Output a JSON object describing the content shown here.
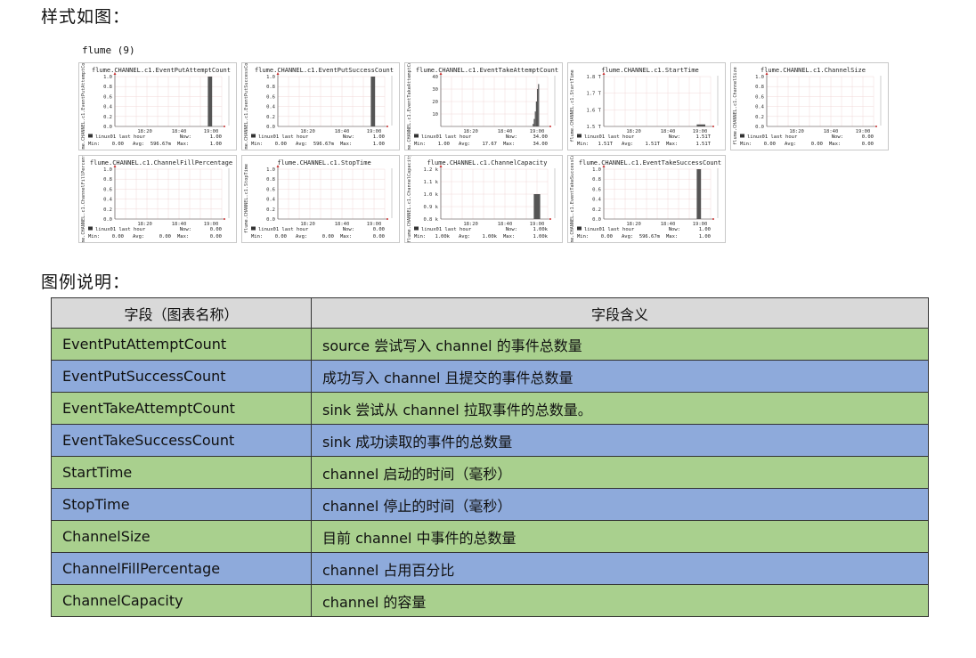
{
  "headings": {
    "style": "样式如图：",
    "legend": "图例说明："
  },
  "section_title": "flume (9)",
  "chart_data": [
    {
      "type": "bar",
      "title": "flume.CHANNEL.c1.EventPutAttemptCount",
      "ylabel": "flume.CHANNEL.c1.EventPutAttemptCount",
      "y_ticks": [
        "1.0",
        "0.8",
        "0.6",
        "0.4",
        "0.2",
        "0.0"
      ],
      "x_ticks": [
        "18:20",
        "18:40",
        "19:00"
      ],
      "bars": [
        {
          "x": 0.87,
          "w": 0.04,
          "v": 1.0
        }
      ],
      "legend_line": "linux01 last hour",
      "now": "1.00",
      "min": "0.00",
      "avg": "596.67m",
      "max": "1.00"
    },
    {
      "type": "bar",
      "title": "flume.CHANNEL.c1.EventPutSuccessCount",
      "ylabel": "flume.CHANNEL.c1.EventPutSuccessCount",
      "y_ticks": [
        "1.0",
        "0.8",
        "0.6",
        "0.4",
        "0.2",
        "0.0"
      ],
      "x_ticks": [
        "18:20",
        "18:40",
        "19:00"
      ],
      "bars": [
        {
          "x": 0.87,
          "w": 0.04,
          "v": 1.0
        }
      ],
      "legend_line": "linux01 last hour",
      "now": "1.00",
      "min": "0.00",
      "avg": "596.67m",
      "max": "1.00"
    },
    {
      "type": "bar",
      "title": "flume.CHANNEL.c1.EventTakeAttemptCount",
      "ylabel": "flume.CHANNEL.c1.EventTakeAttemptCount",
      "y_ticks": [
        "40",
        "30",
        "20",
        "10",
        ""
      ],
      "x_ticks": [
        "18:20",
        "18:40",
        "19:00"
      ],
      "bars": [
        {
          "x": 0.86,
          "w": 0.01,
          "v": 0.05
        },
        {
          "x": 0.87,
          "w": 0.01,
          "v": 0.15
        },
        {
          "x": 0.88,
          "w": 0.01,
          "v": 0.3
        },
        {
          "x": 0.89,
          "w": 0.01,
          "v": 0.5
        },
        {
          "x": 0.9,
          "w": 0.01,
          "v": 0.75
        },
        {
          "x": 0.91,
          "w": 0.01,
          "v": 0.85
        }
      ],
      "legend_line": "linux01 last hour",
      "now": "34.00",
      "min": "1.00",
      "avg": "17.67",
      "max": "34.00"
    },
    {
      "type": "bar",
      "title": "flume.CHANNEL.c1.StartTime",
      "ylabel": "flume.CHANNEL.c1.StartTime",
      "y_ticks": [
        "1.8 T",
        "1.7 T",
        "1.6 T",
        "1.5 T"
      ],
      "x_ticks": [
        "18:20",
        "18:40",
        "19:00"
      ],
      "bars": [
        {
          "x": 0.87,
          "w": 0.08,
          "v": 0.04
        }
      ],
      "legend_line": "linux01 last hour",
      "now": "1.51T",
      "min": "1.51T",
      "avg": "1.51T",
      "max": "1.51T"
    },
    {
      "type": "bar",
      "title": "flume.CHANNEL.c1.ChannelSize",
      "ylabel": "flume.CHANNEL.c1.ChannelSize",
      "y_ticks": [
        "1.0",
        "0.8",
        "0.6",
        "0.4",
        "0.2",
        "0.0"
      ],
      "x_ticks": [
        "18:20",
        "18:40",
        "19:00"
      ],
      "bars": [],
      "legend_line": "linux01 last hour",
      "now": "0.00",
      "min": "0.00",
      "avg": "0.00",
      "max": "0.00"
    },
    {
      "type": "bar",
      "title": "flume.CHANNEL.c1.ChannelFillPercentage",
      "ylabel": "flume.CHANNEL.c1.ChannelFillPercentage",
      "y_ticks": [
        "1.0",
        "0.8",
        "0.6",
        "0.4",
        "0.2",
        "0.0"
      ],
      "x_ticks": [
        "18:20",
        "18:40",
        "19:00"
      ],
      "bars": [],
      "legend_line": "linux01 last hour",
      "now": "0.00",
      "min": "0.00",
      "avg": "0.00",
      "max": "0.00"
    },
    {
      "type": "bar",
      "title": "flume.CHANNEL.c1.StopTime",
      "ylabel": "flume.CHANNEL.c1.StopTime",
      "y_ticks": [
        "1.0",
        "0.8",
        "0.6",
        "0.4",
        "0.2",
        "0.0"
      ],
      "x_ticks": [
        "18:20",
        "18:40",
        "19:00"
      ],
      "bars": [],
      "legend_line": "linux01 last hour",
      "now": "0.00",
      "min": "0.00",
      "avg": "0.00",
      "max": "0.00"
    },
    {
      "type": "bar",
      "title": "flume.CHANNEL.c1.ChannelCapacity",
      "ylabel": "flume.CHANNEL.c1.ChannelCapacity",
      "y_ticks": [
        "1.2 k",
        "1.1 k",
        "1.0 k",
        "0.9 k",
        "0.8 k"
      ],
      "x_ticks": [
        "18:20",
        "18:40",
        "19:00"
      ],
      "bars": [
        {
          "x": 0.87,
          "w": 0.06,
          "v": 0.5
        }
      ],
      "legend_line": "linux01 last hour",
      "now": "1.00k",
      "min": "1.00k",
      "avg": "1.00k",
      "max": "1.00k"
    },
    {
      "type": "bar",
      "title": "flume.CHANNEL.c1.EventTakeSuccessCount",
      "ylabel": "flume.CHANNEL.c1.EventTakeSuccessCount",
      "y_ticks": [
        "1.0",
        "0.8",
        "0.6",
        "0.4",
        "0.2",
        "0.0"
      ],
      "x_ticks": [
        "18:20",
        "18:40",
        "19:00"
      ],
      "bars": [
        {
          "x": 0.87,
          "w": 0.04,
          "v": 1.0
        }
      ],
      "legend_line": "linux01 last hour",
      "now": "1.00",
      "min": "0.00",
      "avg": "596.67m",
      "max": "1.00"
    }
  ],
  "legend_table": {
    "headers": [
      "字段（图表名称）",
      "字段含义"
    ],
    "rows": [
      {
        "name": "EventPutAttemptCount",
        "desc": "source 尝试写入 channel 的事件总数量",
        "color": "#a9d08e"
      },
      {
        "name": "EventPutSuccessCount",
        "desc": "成功写入 channel 且提交的事件总数量",
        "color": "#8eaadb"
      },
      {
        "name": "EventTakeAttemptCount",
        "desc": "sink 尝试从 channel 拉取事件的总数量。",
        "color": "#a9d08e"
      },
      {
        "name": "EventTakeSuccessCount",
        "desc": "sink 成功读取的事件的总数量",
        "color": "#8eaadb"
      },
      {
        "name": "StartTime",
        "desc": "channel 启动的时间（毫秒）",
        "color": "#a9d08e"
      },
      {
        "name": "StopTime",
        "desc": "channel 停止的时间（毫秒）",
        "color": "#8eaadb"
      },
      {
        "name": "ChannelSize",
        "desc": "目前 channel 中事件的总数量",
        "color": "#a9d08e"
      },
      {
        "name": "ChannelFillPercentage",
        "desc": "channel 占用百分比",
        "color": "#8eaadb"
      },
      {
        "name": "ChannelCapacity",
        "desc": "channel 的容量",
        "color": "#a9d08e"
      }
    ]
  }
}
